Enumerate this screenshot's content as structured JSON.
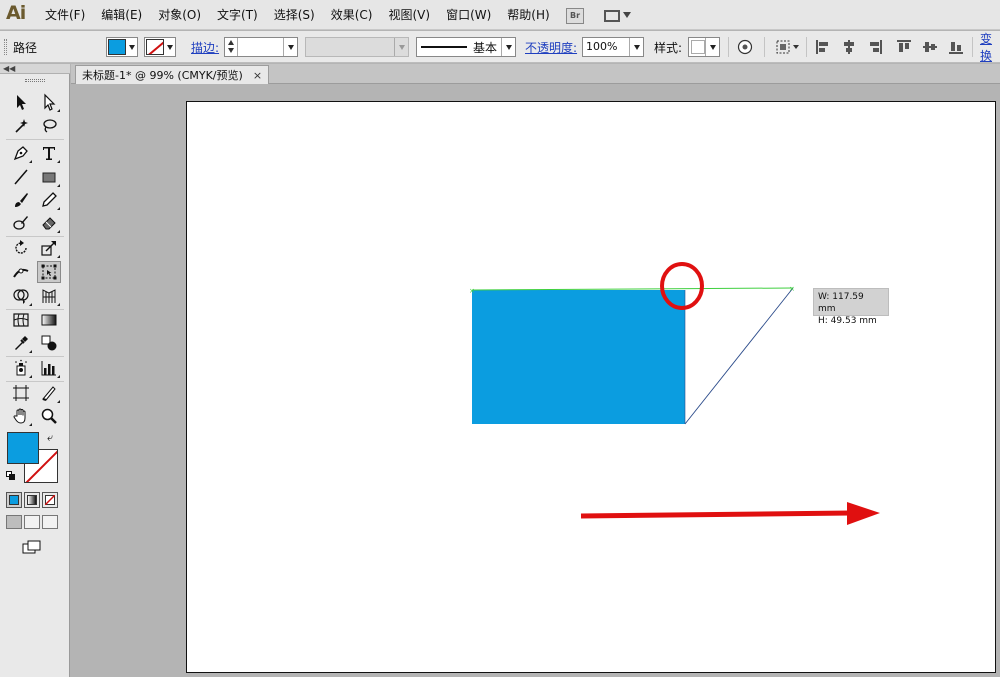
{
  "app": {
    "logo": "Ai"
  },
  "menu": [
    "文件(F)",
    "编辑(E)",
    "对象(O)",
    "文字(T)",
    "选择(S)",
    "效果(C)",
    "视图(V)",
    "窗口(W)",
    "帮助(H)"
  ],
  "menubar": {
    "bridge_label": "Br"
  },
  "control_bar": {
    "selection_label": "路径",
    "fill_color": "#0b9de0",
    "stroke_label": "描边:",
    "stroke_weight": "",
    "profile_label": "基本",
    "opacity_label": "不透明度:",
    "opacity_value": "100%",
    "style_label": "样式:",
    "transform_label": "变换"
  },
  "document": {
    "tab_title": "未标题-1* @ 99% (CMYK/预览)",
    "close_glyph": "×"
  },
  "tooltip": {
    "width": "W: 117.59 mm",
    "height": "H: 49.53 mm"
  },
  "colors": {
    "fill": "#0b9de0",
    "annotation": "#e01010",
    "guide": "#3fcf3f",
    "ui_bg": "#e9e9e9"
  },
  "tools": [
    "selection-tool",
    "direct-selection-tool",
    "magic-wand-tool",
    "lasso-tool",
    "pen-tool",
    "type-tool",
    "line-segment-tool",
    "rectangle-tool",
    "paintbrush-tool",
    "pencil-tool",
    "blob-brush-tool",
    "eraser-tool",
    "rotate-tool",
    "scale-tool",
    "width-tool",
    "free-transform-tool",
    "shape-builder-tool",
    "perspective-grid-tool",
    "mesh-tool",
    "gradient-tool",
    "eyedropper-tool",
    "blend-tool",
    "symbol-sprayer-tool",
    "column-graph-tool",
    "artboard-tool",
    "slice-tool",
    "hand-tool",
    "zoom-tool"
  ]
}
